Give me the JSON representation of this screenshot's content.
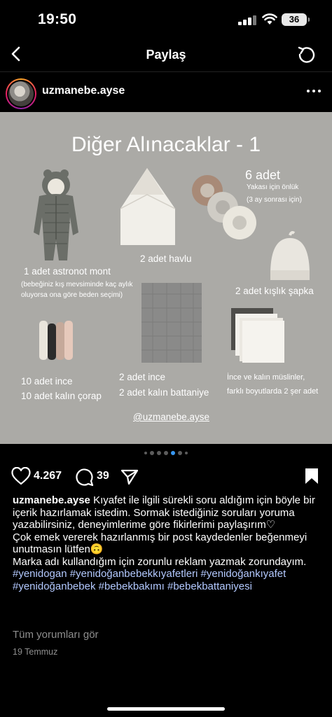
{
  "status_bar": {
    "time": "19:50",
    "battery": "36"
  },
  "header": {
    "title": "Paylaş"
  },
  "post": {
    "username": "uzmanebe.ayse",
    "image": {
      "title": "Diğer Alınacaklar - 1",
      "items": {
        "astronaut": "1 adet astronot mont",
        "astronaut_note_1": "(bebeğiniz kış mevsiminde kaç aylık",
        "astronaut_note_2": "oluyorsa ona göre beden seçimi)",
        "towel": "2 adet havlu",
        "bib_count": "6 adet",
        "bib_desc": "Yakası için önlük",
        "bib_note": "(3 ay sonrası için)",
        "hat": "2 adet kışlık şapka",
        "socks_1": "10 adet ince",
        "socks_2": "10 adet kalın çorap",
        "blanket_1": "2 adet ince",
        "blanket_2": "2 adet kalın battaniye",
        "muslin_1": "İnce ve kalın müslinler,",
        "muslin_2": "farklı boyutlarda 2 şer adet",
        "handle": "@uzmanebe.ayse"
      }
    },
    "likes": "4.267",
    "comments_count": "39",
    "caption": {
      "username": "uzmanebe.ayse",
      "line1": "Kıyafet ile ilgili sürekli soru aldığım için böyle bir içerik hazırlamak istedim. Sormak istediğiniz soruları yoruma yazabilirsiniz, deneyimlerime göre fikirlerimi paylaşırım♡",
      "line2": "Çok emek vererek hazırlanmış bir post kaydedenler beğenmeyi unutmasın lütfen🙃",
      "line3": "Marka adı kullandığım için zorunlu reklam yazmak zorundayım.",
      "hashtags": "#yenidogan #yenidoğanbebekkıyafetleri #yenidoğankıyafet #yenidoğanbebek #bebekbakımı #bebekbattaniyesi"
    },
    "view_comments": "Tüm yorumları gör",
    "date": "19 Temmuz"
  }
}
